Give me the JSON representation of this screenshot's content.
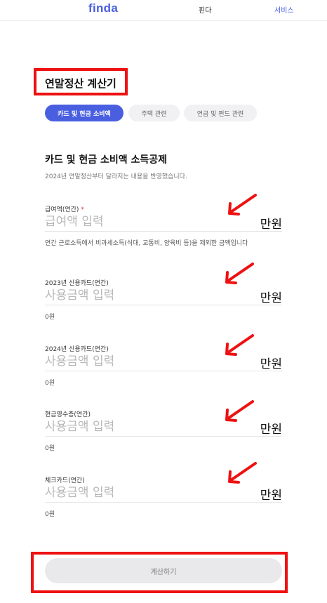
{
  "header": {
    "logo": "finda",
    "nav_finda": "핀다",
    "nav_service": "서비스"
  },
  "page": {
    "title": "연말정산 계산기"
  },
  "tabs": [
    {
      "label": "카드 및 현금 소비액",
      "active": true
    },
    {
      "label": "주택 관련",
      "active": false
    },
    {
      "label": "연금 및 펀드 관련",
      "active": false
    }
  ],
  "section": {
    "title": "카드 및 현금 소비액 소득공제",
    "subtitle": "2024년 연말정산부터 달라지는 내용을 반영했습니다."
  },
  "fields": [
    {
      "label": "급여액(연간)",
      "required_mark": "*",
      "placeholder": "급여액 입력",
      "unit": "만원",
      "help": "연간 근로소득에서 비과세소득(식대, 교통비, 양육비 등)을 제외한 금액입니다"
    },
    {
      "label": "2023년 신용카드(연간)",
      "placeholder": "사용금액 입력",
      "unit": "만원",
      "help": "0원"
    },
    {
      "label": "2024년 신용카드(연간)",
      "placeholder": "사용금액 입력",
      "unit": "만원",
      "help": "0원"
    },
    {
      "label": "현금영수증(연간)",
      "placeholder": "사용금액 입력",
      "unit": "만원",
      "help": "0원"
    },
    {
      "label": "체크카드(연간)",
      "placeholder": "사용금액 입력",
      "unit": "만원",
      "help": "0원"
    }
  ],
  "calculate_button": {
    "label": "계산하기"
  },
  "colors": {
    "accent": "#4a5fe0",
    "annotation_red": "#ee1111",
    "disabled_button": "#e9e9eb"
  }
}
